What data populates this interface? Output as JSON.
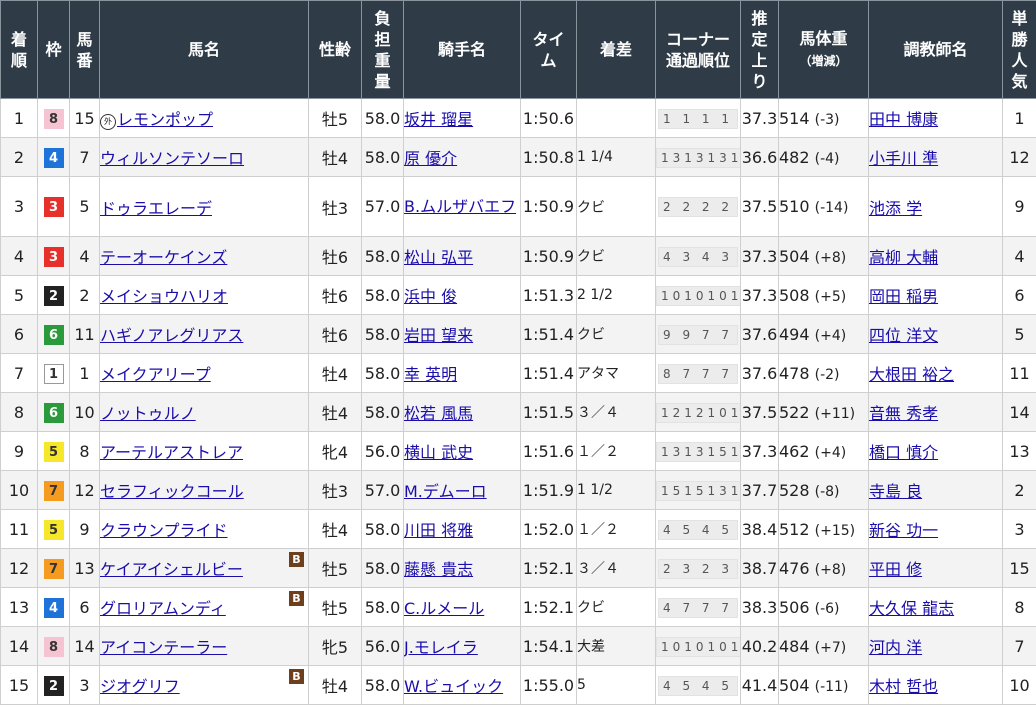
{
  "headers": {
    "rank": [
      "着",
      "順"
    ],
    "waku": "枠",
    "umaban": [
      "馬",
      "番"
    ],
    "horse": "馬名",
    "sexage": "性齢",
    "weight": [
      "負",
      "担",
      "重",
      "量"
    ],
    "jockey": "騎手名",
    "time": [
      "タイ",
      "ム"
    ],
    "margin": "着差",
    "corner": [
      "コーナー",
      "通過順位"
    ],
    "last3f": [
      "推",
      "定",
      "上",
      "り"
    ],
    "bodyweight": [
      "馬体重",
      "（増減）"
    ],
    "trainer": "調教師名",
    "popularity": [
      "単",
      "勝",
      "人",
      "気"
    ]
  },
  "waku_colors": {
    "1": {
      "bg": "#ffffff",
      "fg": "#333333",
      "border": "#999999"
    },
    "2": {
      "bg": "#222222",
      "fg": "#ffffff",
      "border": "#222222"
    },
    "3": {
      "bg": "#e8302a",
      "fg": "#ffffff",
      "border": "#e8302a"
    },
    "4": {
      "bg": "#1e73d9",
      "fg": "#ffffff",
      "border": "#1e73d9"
    },
    "5": {
      "bg": "#f7e72a",
      "fg": "#333333",
      "border": "#f7e72a"
    },
    "6": {
      "bg": "#2a9a3c",
      "fg": "#ffffff",
      "border": "#2a9a3c"
    },
    "7": {
      "bg": "#f59b1f",
      "fg": "#333333",
      "border": "#f59b1f"
    },
    "8": {
      "bg": "#f6c3d2",
      "fg": "#333333",
      "border": "#f6c3d2"
    }
  },
  "rows": [
    {
      "rank": "1",
      "waku": "8",
      "umaban": "15",
      "gaikoku": "外",
      "horse": "レモンポップ",
      "blinker": "",
      "sexage": "牡5",
      "weight": "58.0",
      "jockey": "坂井 瑠星",
      "time": "1:50.6",
      "margin": "",
      "corner": "1 1 1 1",
      "last3f": "37.3",
      "bw": "514",
      "bwdiff": "(-3)",
      "trainer": "田中 博康",
      "pop": "1"
    },
    {
      "rank": "2",
      "waku": "4",
      "umaban": "7",
      "gaikoku": "",
      "horse": "ウィルソンテソーロ",
      "blinker": "",
      "sexage": "牡4",
      "weight": "58.0",
      "jockey": "原 優介",
      "time": "1:50.8",
      "margin": "1 1/4",
      "corner": "13131313",
      "last3f": "36.6",
      "bw": "482",
      "bwdiff": "(-4)",
      "trainer": "小手川 準",
      "pop": "12"
    },
    {
      "rank": "3",
      "waku": "3",
      "umaban": "5",
      "gaikoku": "",
      "horse": "ドゥラエレーデ",
      "blinker": "",
      "sexage": "牡3",
      "weight": "57.0",
      "jockey": "B.ムルザバエフ",
      "time": "1:50.9",
      "margin": "クビ",
      "corner": "2 2 2 2",
      "last3f": "37.5",
      "bw": "510",
      "bwdiff": "(-14)",
      "trainer": "池添 学",
      "pop": "9"
    },
    {
      "rank": "4",
      "waku": "3",
      "umaban": "4",
      "gaikoku": "",
      "horse": "テーオーケインズ",
      "blinker": "",
      "sexage": "牡6",
      "weight": "58.0",
      "jockey": "松山 弘平",
      "time": "1:50.9",
      "margin": "クビ",
      "corner": "4 3 4 3",
      "last3f": "37.3",
      "bw": "504",
      "bwdiff": "(+8)",
      "trainer": "高柳 大輔",
      "pop": "4"
    },
    {
      "rank": "5",
      "waku": "2",
      "umaban": "2",
      "gaikoku": "",
      "horse": "メイショウハリオ",
      "blinker": "",
      "sexage": "牡6",
      "weight": "58.0",
      "jockey": "浜中 俊",
      "time": "1:51.3",
      "margin": "2 1/2",
      "corner": "10101010",
      "last3f": "37.3",
      "bw": "508",
      "bwdiff": "(+5)",
      "trainer": "岡田 稲男",
      "pop": "6"
    },
    {
      "rank": "6",
      "waku": "6",
      "umaban": "11",
      "gaikoku": "",
      "horse": "ハギノアレグリアス",
      "blinker": "",
      "sexage": "牡6",
      "weight": "58.0",
      "jockey": "岩田 望来",
      "time": "1:51.4",
      "margin": "クビ",
      "corner": "9 9 7 7",
      "last3f": "37.6",
      "bw": "494",
      "bwdiff": "(+4)",
      "trainer": "四位 洋文",
      "pop": "5"
    },
    {
      "rank": "7",
      "waku": "1",
      "umaban": "1",
      "gaikoku": "",
      "horse": "メイクアリープ",
      "blinker": "",
      "sexage": "牡4",
      "weight": "58.0",
      "jockey": "幸 英明",
      "time": "1:51.4",
      "margin": "アタマ",
      "corner": "8 7 7 7",
      "last3f": "37.6",
      "bw": "478",
      "bwdiff": "(-2)",
      "trainer": "大根田 裕之",
      "pop": "11"
    },
    {
      "rank": "8",
      "waku": "6",
      "umaban": "10",
      "gaikoku": "",
      "horse": "ノットゥルノ",
      "blinker": "",
      "sexage": "牡4",
      "weight": "58.0",
      "jockey": "松若 風馬",
      "time": "1:51.5",
      "margin": "３／４",
      "corner": "12121011",
      "last3f": "37.5",
      "bw": "522",
      "bwdiff": "(+11)",
      "trainer": "音無 秀孝",
      "pop": "14"
    },
    {
      "rank": "9",
      "waku": "5",
      "umaban": "8",
      "gaikoku": "",
      "horse": "アーテルアストレア",
      "blinker": "",
      "sexage": "牝4",
      "weight": "56.0",
      "jockey": "横山 武史",
      "time": "1:51.6",
      "margin": "１／２",
      "corner": "13131513",
      "last3f": "37.3",
      "bw": "462",
      "bwdiff": "(+4)",
      "trainer": "橋口 慎介",
      "pop": "13"
    },
    {
      "rank": "10",
      "waku": "7",
      "umaban": "12",
      "gaikoku": "",
      "horse": "セラフィックコール",
      "blinker": "",
      "sexage": "牡3",
      "weight": "57.0",
      "jockey": "M.デムーロ",
      "time": "1:51.9",
      "margin": "1 1/2",
      "corner": "15151313",
      "last3f": "37.7",
      "bw": "528",
      "bwdiff": "(-8)",
      "trainer": "寺島 良",
      "pop": "2"
    },
    {
      "rank": "11",
      "waku": "5",
      "umaban": "9",
      "gaikoku": "",
      "horse": "クラウンプライド",
      "blinker": "",
      "sexage": "牡4",
      "weight": "58.0",
      "jockey": "川田 将雅",
      "time": "1:52.0",
      "margin": "１／２",
      "corner": "4 5 4 5",
      "last3f": "38.4",
      "bw": "512",
      "bwdiff": "(+15)",
      "trainer": "新谷 功一",
      "pop": "3"
    },
    {
      "rank": "12",
      "waku": "7",
      "umaban": "13",
      "gaikoku": "",
      "horse": "ケイアイシェルビー",
      "blinker": "B",
      "sexage": "牡5",
      "weight": "58.0",
      "jockey": "藤懸 貴志",
      "time": "1:52.1",
      "margin": "３／４",
      "corner": "2 3 2 3",
      "last3f": "38.7",
      "bw": "476",
      "bwdiff": "(+8)",
      "trainer": "平田 修",
      "pop": "15"
    },
    {
      "rank": "13",
      "waku": "4",
      "umaban": "6",
      "gaikoku": "",
      "horse": "グロリアムンディ",
      "blinker": "B",
      "sexage": "牡5",
      "weight": "58.0",
      "jockey": "C.ルメール",
      "time": "1:52.1",
      "margin": "クビ",
      "corner": "4 7 7 7",
      "last3f": "38.3",
      "bw": "506",
      "bwdiff": "(-6)",
      "trainer": "大久保 龍志",
      "pop": "8"
    },
    {
      "rank": "14",
      "waku": "8",
      "umaban": "14",
      "gaikoku": "",
      "horse": "アイコンテーラー",
      "blinker": "",
      "sexage": "牝5",
      "weight": "56.0",
      "jockey": "J.モレイラ",
      "time": "1:54.1",
      "margin": "大差",
      "corner": "10101011",
      "last3f": "40.2",
      "bw": "484",
      "bwdiff": "(+7)",
      "trainer": "河内 洋",
      "pop": "7"
    },
    {
      "rank": "15",
      "waku": "2",
      "umaban": "3",
      "gaikoku": "",
      "horse": "ジオグリフ",
      "blinker": "B",
      "sexage": "牡4",
      "weight": "58.0",
      "jockey": "W.ビュイック",
      "time": "1:55.0",
      "margin": "5",
      "corner": "4 5 4 5",
      "last3f": "41.4",
      "bw": "504",
      "bwdiff": "(-11)",
      "trainer": "木村 哲也",
      "pop": "10"
    }
  ]
}
